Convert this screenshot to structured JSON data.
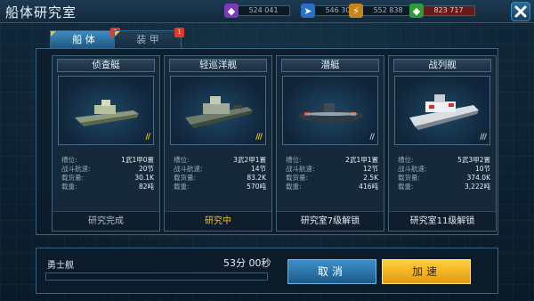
{
  "header": {
    "title": "船体研究室",
    "resources": [
      {
        "icon": "purple-crystal-icon",
        "color": "#9a4fd6",
        "value": "524 041"
      },
      {
        "icon": "blue-wing-icon",
        "color": "#2f7fe0",
        "value": "546 301"
      },
      {
        "icon": "lightning-icon",
        "color": "#e0a21e",
        "value": "552 838"
      },
      {
        "icon": "green-gem-icon",
        "color": "#3ec24a",
        "value": "823 717"
      }
    ]
  },
  "tabs": [
    {
      "label": "船 体",
      "badge": "1",
      "active": true
    },
    {
      "label": "装 甲",
      "badge": "1",
      "active": false
    }
  ],
  "stat_labels": [
    "槽位:",
    "战斗航速:",
    "载货量:",
    "载重:"
  ],
  "cards": [
    {
      "name": "侦查艇",
      "slots": "1武1甲0置",
      "speed": "20节",
      "cargo": "30.1K",
      "weight": "82吨",
      "status": "研究完成",
      "status_color": "#aebdc8",
      "stripe_color": "#e8c51a"
    },
    {
      "name": "轻巡洋舰",
      "slots": "3武2甲1置",
      "speed": "14节",
      "cargo": "83.2K",
      "weight": "570吨",
      "status": "研究中",
      "status_color": "#f2c21e",
      "stripe_color": "#f2c21e"
    },
    {
      "name": "潜艇",
      "slots": "2武1甲1置",
      "speed": "12节",
      "cargo": "2.5K",
      "weight": "416吨",
      "status": "研究室7级解锁",
      "status_color": "#e4ecf2",
      "stripe_color": "#b9c3cb"
    },
    {
      "name": "战列舰",
      "slots": "5武3甲2置",
      "speed": "10节",
      "cargo": "374.0K",
      "weight": "3,222吨",
      "status": "研究室11级解锁",
      "status_color": "#e4ecf2",
      "stripe_color": "#b9c3cb"
    }
  ],
  "bottom": {
    "ship": "勇士舰",
    "timer": "53分 00秒",
    "progress": 0.0,
    "cancel": "取消",
    "speedup": "加速"
  }
}
